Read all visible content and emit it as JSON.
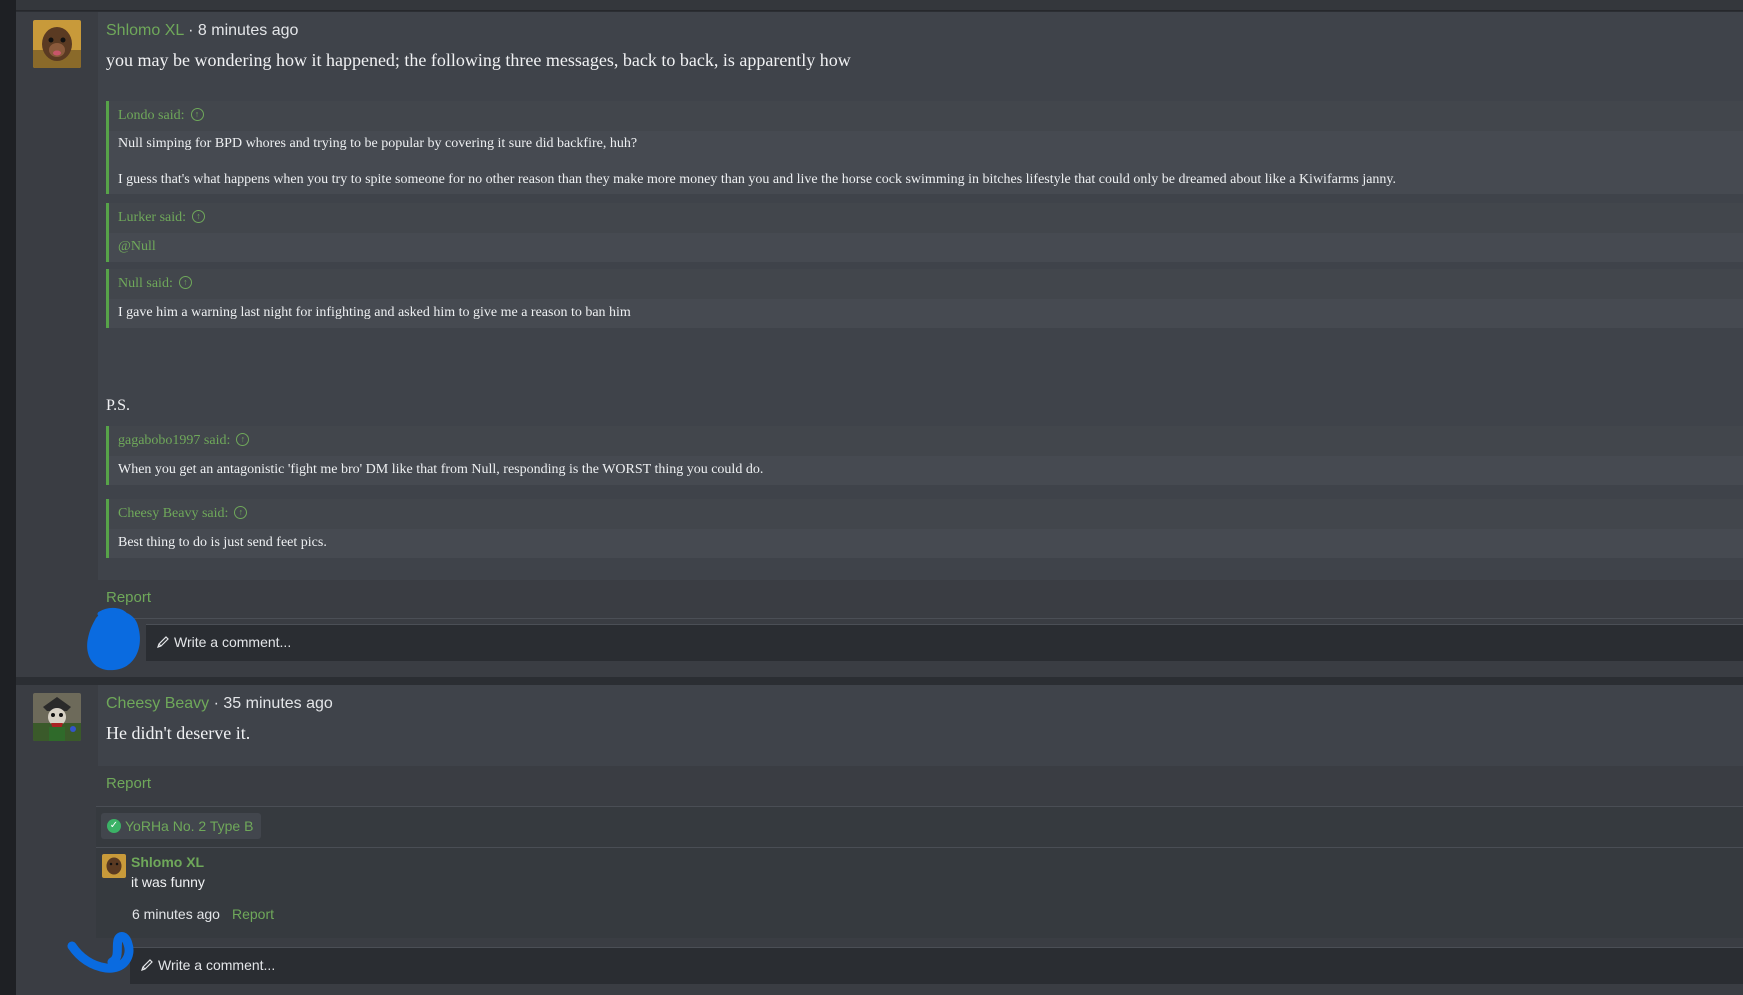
{
  "posts": [
    {
      "username": "Shlomo XL",
      "separator": "·",
      "time": "8 minutes ago",
      "text": "you may be wondering how it happened; the following three messages, back to back, is apparently how",
      "quotes": [
        {
          "author_line": "Londo said:",
          "paragraphs": [
            "Null simping for BPD whores and trying to be popular by covering it sure did backfire, huh?",
            "I guess that's what happens when you try to spite someone for no other reason than they make more money than you and live the horse cock swimming in bitches lifestyle that could only be dreamed about like a Kiwifarms janny."
          ]
        },
        {
          "author_line": "Lurker said:",
          "mention": "@Null"
        },
        {
          "author_line": "Null said:",
          "paragraphs": [
            "I gave him a warning last night for infighting and asked him to give me a reason to ban him"
          ]
        }
      ],
      "ps": "P.S.",
      "ps_quotes": [
        {
          "author_line": "gagabobo1997 said:",
          "paragraphs": [
            "When you get an antagonistic 'fight me bro' DM like that from Null, responding is the WORST thing you could do."
          ]
        },
        {
          "author_line": "Cheesy Beavy said:",
          "paragraphs": [
            "Best thing to do is just send feet pics."
          ]
        }
      ],
      "report_label": "Report",
      "comment_placeholder": "Write a comment..."
    },
    {
      "username": "Cheesy Beavy",
      "separator": "·",
      "time": "35 minutes ago",
      "text": "He didn't deserve it.",
      "report_label": "Report",
      "reaction": "YoRHa No. 2 Type B",
      "comment": {
        "username": "Shlomo XL",
        "text": "it was funny",
        "time": "6 minutes ago",
        "report_label": "Report"
      },
      "comment_placeholder": "Write a comment..."
    }
  ],
  "icons": {
    "jump_to_quote": "arrow-up-circle-icon",
    "pencil": "pencil-icon",
    "reaction_check": "check-circle-icon"
  },
  "colors": {
    "accent_green": "#6fa85a",
    "quote_border": "#57a349",
    "scribble_blue": "#0a6be0"
  }
}
